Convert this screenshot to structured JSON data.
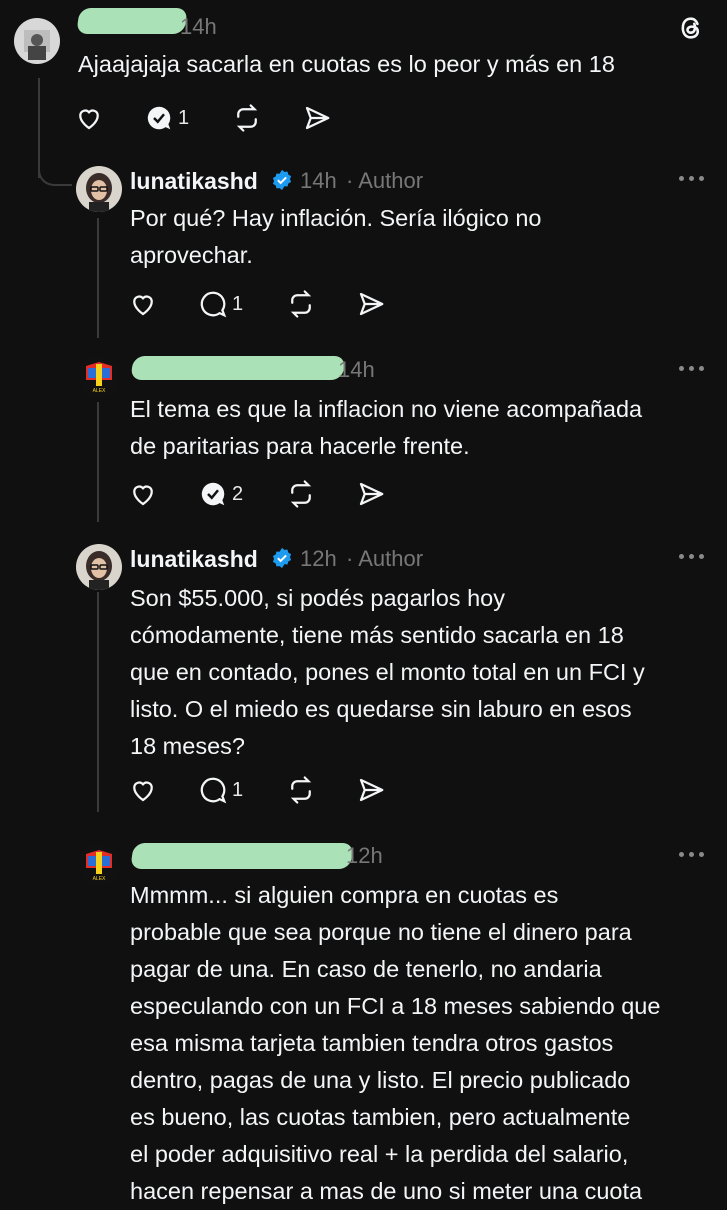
{
  "app": {
    "logo_icon": "threads-logo-icon"
  },
  "colors": {
    "background": "#101010",
    "text": "#f3f5f7",
    "muted": "#777777",
    "verified": "#1d9bf0",
    "redaction": "#b9f3c4"
  },
  "posts": [
    {
      "username": "",
      "time": "14h",
      "author_tag": "",
      "text": "Ajaajajaja sacarla en cuotas es lo peor y más en 18",
      "actions": {
        "like_count": "",
        "reply_count": "1",
        "repost_count": "",
        "reply_icon": "reply-check-icon"
      }
    },
    {
      "username": "lunatikashd",
      "time": "14h",
      "author_tag": "· Author",
      "text": "Por qué? Hay inflación. Sería ilógico no\naprovechar.",
      "actions": {
        "like_count": "",
        "reply_count": "1",
        "repost_count": ""
      }
    },
    {
      "username": "",
      "time": "14h",
      "author_tag": "",
      "text": "El tema es que la inflacion no viene acompañada\nde paritarias para hacerle frente.",
      "actions": {
        "like_count": "",
        "reply_count": "2",
        "repost_count": "",
        "reply_icon": "reply-check-icon"
      }
    },
    {
      "username": "lunatikashd",
      "time": "12h",
      "author_tag": "· Author",
      "text": "Son $55.000, si podés pagarlos hoy\ncómodamente, tiene más sentido sacarla en 18\nque en contado, pones el monto total en un FCI y\nlisto. O el miedo es quedarse sin laburo en esos\n18 meses?",
      "actions": {
        "like_count": "",
        "reply_count": "1",
        "repost_count": ""
      }
    },
    {
      "username": "",
      "time": "12h",
      "author_tag": "",
      "text": "Mmmm... si alguien compra en cuotas es\nprobable que sea porque no tiene el dinero para\npagar de una. En caso de tenerlo, no andaria\nespeculando con un FCI a 18 meses sabiendo que\nesa misma tarjeta tambien tendra otros gastos\ndentro, pagas de una y listo. El precio publicado\nes bueno, las cuotas tambien, pero actualmente\nel poder adquisitivo real + la perdida del salario,\nhacen repensar a mas de uno si meter una cuota"
    }
  ]
}
